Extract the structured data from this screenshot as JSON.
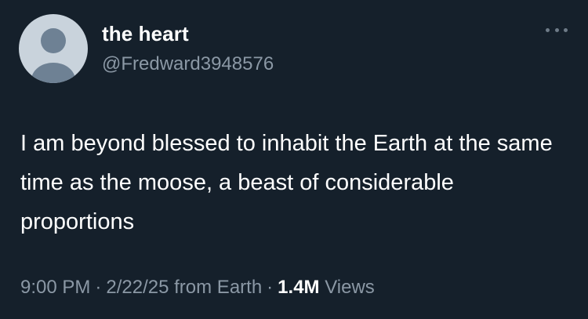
{
  "tweet": {
    "display_name": "the heart",
    "handle": "@Fredward3948576",
    "text": "I am beyond blessed to inhabit the Earth at the same time as the moose, a beast of considerable proportions",
    "time": "9:00 PM",
    "date": "2/22/25",
    "source": "from Earth",
    "separator": "·",
    "views_count": "1.4M",
    "views_label": "Views"
  },
  "icons": {
    "avatar": "default-avatar-icon",
    "more": "more-options-icon"
  },
  "colors": {
    "background": "#15202b",
    "primary_text": "#ffffff",
    "secondary_text": "#8b98a5",
    "avatar_bg": "#c9d3dc",
    "avatar_figure": "#8597a8"
  }
}
